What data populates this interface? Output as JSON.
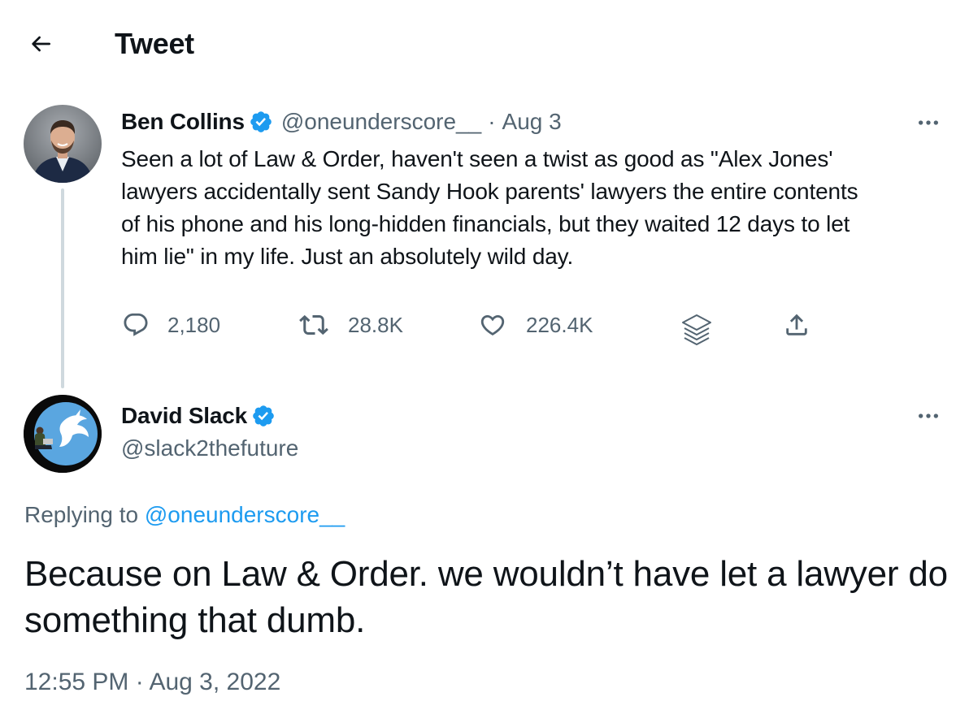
{
  "header": {
    "title": "Tweet"
  },
  "parent_tweet": {
    "author_name": "Ben Collins",
    "author_handle": "@oneunderscore__",
    "separator": "·",
    "date": "Aug 3",
    "text": "Seen a lot of Law & Order, haven't seen a twist as good as \"Alex Jones'\nlawyers accidentally sent Sandy Hook parents' lawyers the entire contents\nof his phone and his long-hidden financials, but they waited 12 days to let\nhim lie\" in my life. Just an absolutely wild day.",
    "stats": {
      "replies": "2,180",
      "retweets": "28.8K",
      "likes": "226.4K"
    }
  },
  "reply_tweet": {
    "author_name": "David Slack",
    "author_handle": "@slack2thefuture",
    "replying_prefix": "Replying to",
    "replying_to": "@oneunderscore__",
    "text": "Because on Law & Order. we wouldn’t have let a lawyer do something that dumb.",
    "time": "12:55 PM",
    "separator": "·",
    "date": "Aug 3, 2022"
  },
  "colors": {
    "accent": "#1d9bf0",
    "muted_text": "#536471",
    "primary_text": "#0f1419",
    "thread_line": "#cfd9de"
  },
  "icons": {
    "back": "arrow-left-icon",
    "verified": "verified-badge-icon",
    "more": "more-horizontal-icon",
    "reply": "reply-icon",
    "retweet": "retweet-icon",
    "like": "heart-icon",
    "revue": "layers-icon",
    "share": "share-icon"
  }
}
